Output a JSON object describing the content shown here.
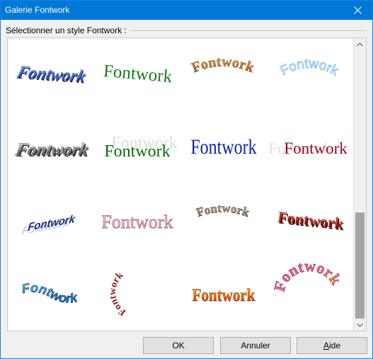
{
  "window": {
    "title": "Galerie Fontwork"
  },
  "section": {
    "label": "Sélectionner un style Fontwork :"
  },
  "gallery": {
    "items": [
      {
        "text": "Fontwork",
        "style": "blue-3d-arch"
      },
      {
        "text": "Fontwork",
        "style": "green-serif"
      },
      {
        "text": "Fontwork",
        "style": "orange-arch-up"
      },
      {
        "text": "Fontwork",
        "style": "light-blue-outline-arch"
      },
      {
        "text": "Fontwork",
        "style": "gray-3d-italic"
      },
      {
        "text": "Fontwork",
        "style": "green-shadow"
      },
      {
        "text": "Fontwork",
        "style": "blue-serif"
      },
      {
        "text": "Fontwork",
        "style": "dark-red-shadow"
      },
      {
        "text": "Fontwork",
        "style": "blue-perspective"
      },
      {
        "text": "Fontwork",
        "style": "pink-outline"
      },
      {
        "text": "Fontwork",
        "style": "brown-arch"
      },
      {
        "text": "Fontwork",
        "style": "red-3d"
      },
      {
        "text": "Fontwork",
        "style": "teal-wave-3d"
      },
      {
        "text": "Fontwork",
        "style": "red-circle-arc"
      },
      {
        "text": "Fontwork",
        "style": "orange-gradient"
      },
      {
        "text": "Fontwork",
        "style": "magenta-circle"
      }
    ],
    "scroll_position": 0.62
  },
  "buttons": {
    "ok": "OK",
    "cancel": "Annuler",
    "help_prefix": "",
    "help_mnemonic": "A",
    "help_rest": "ide"
  },
  "colors": {
    "titlebar": "#0078d7",
    "button_face": "#e1e1e1"
  }
}
